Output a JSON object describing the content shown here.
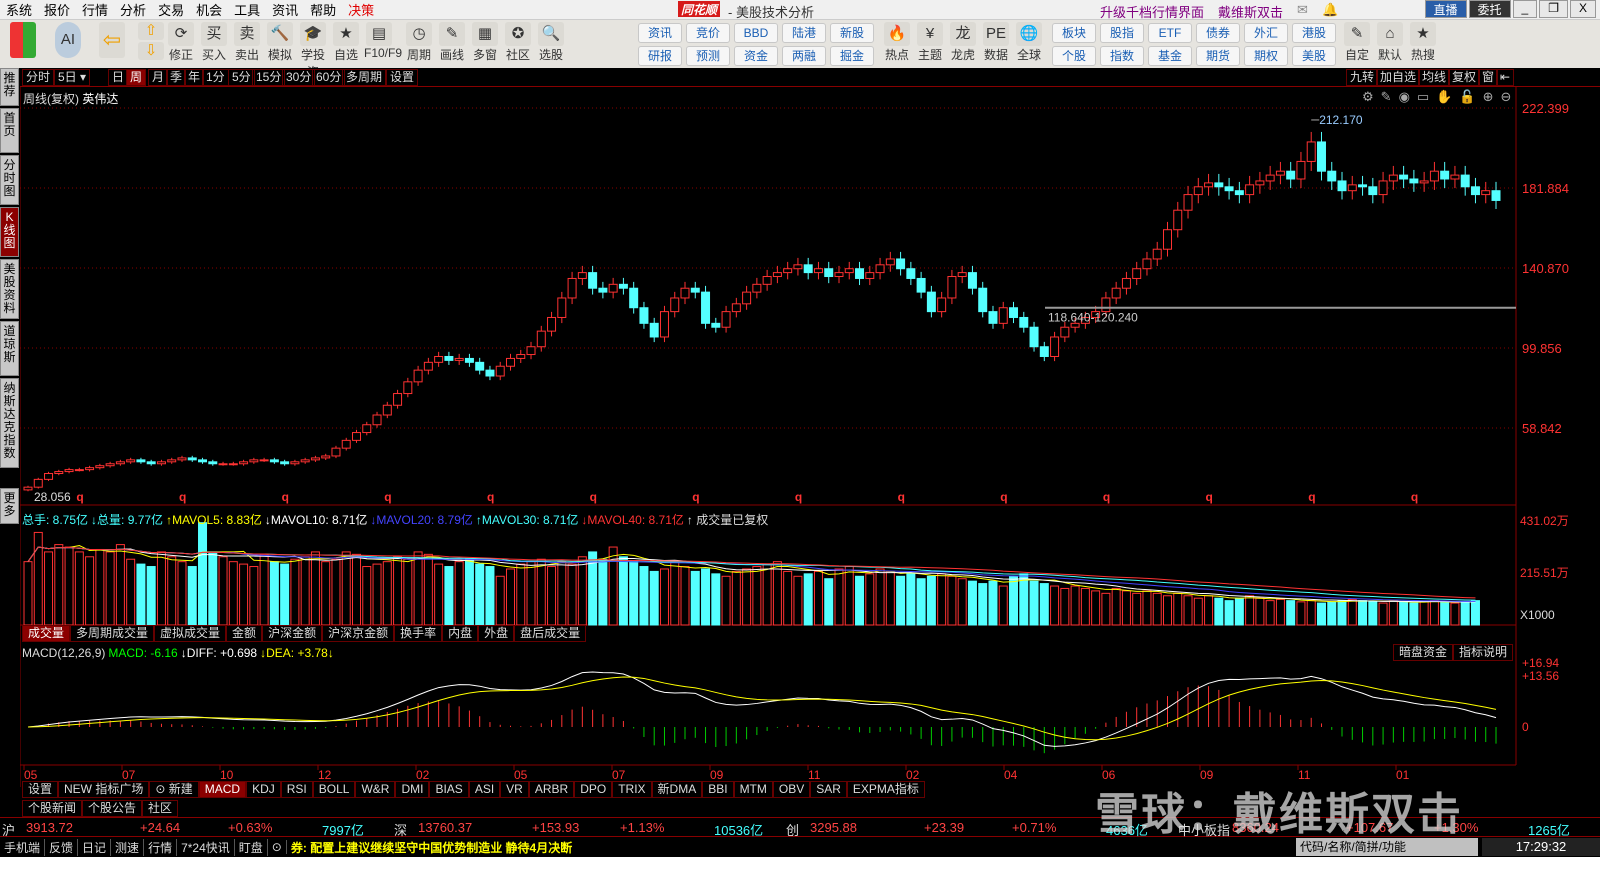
{
  "menu": [
    "系统",
    "报价",
    "行情",
    "分析",
    "交易",
    "机会",
    "工具",
    "资讯",
    "帮助",
    "决策"
  ],
  "app": {
    "logo": "同花顺",
    "title": "- 美股技术分析",
    "links": [
      "升级千档行情界面",
      "戴维斯双击"
    ],
    "live": "直播",
    "entrust": "委托",
    "minimize": "_",
    "restore": "❐",
    "close": "X"
  },
  "toolbar": {
    "big": [
      {
        "label": "修正",
        "icon": "⟳"
      },
      {
        "label": "买入",
        "icon": "买"
      },
      {
        "label": "卖出",
        "icon": "卖"
      },
      {
        "label": "模拟",
        "icon": "🔨"
      },
      {
        "label": "学投资",
        "icon": "🎓"
      },
      {
        "label": "自选",
        "icon": "★"
      },
      {
        "label": "F10/F9",
        "icon": "▤"
      },
      {
        "label": "周期",
        "icon": "◷"
      },
      {
        "label": "画线",
        "icon": "✎"
      },
      {
        "label": "多窗",
        "icon": "▦"
      },
      {
        "label": "社区",
        "icon": "✪"
      },
      {
        "label": "选股",
        "icon": "🔍"
      }
    ],
    "small": [
      [
        "资讯",
        "研报"
      ],
      [
        "竞价",
        "预测"
      ],
      [
        "BBD",
        "资金"
      ],
      [
        "陆港",
        "两融"
      ],
      [
        "新股",
        "掘金"
      ]
    ],
    "big2": [
      {
        "label": "热点",
        "icon": "🔥"
      },
      {
        "label": "主题",
        "icon": "¥"
      },
      {
        "label": "龙虎",
        "icon": "龙"
      },
      {
        "label": "数据",
        "icon": "PE"
      },
      {
        "label": "全球",
        "icon": "🌐"
      }
    ],
    "small2": [
      [
        "板块",
        "个股"
      ],
      [
        "股指",
        "指数"
      ],
      [
        "ETF",
        "基金"
      ],
      [
        "债券",
        "期货"
      ],
      [
        "外汇",
        "期权"
      ],
      [
        "港股",
        "美股"
      ]
    ],
    "big3": [
      {
        "label": "自定",
        "icon": "✎"
      },
      {
        "label": "默认",
        "icon": "⌂"
      },
      {
        "label": "热搜",
        "icon": "★"
      }
    ]
  },
  "periods": [
    "分时",
    "5日 ▾",
    "日",
    "周",
    "月",
    "季",
    "年",
    "1分",
    "5分",
    "15分",
    "30分",
    "60分",
    "多周期",
    "设置"
  ],
  "right_tabs": [
    "九转",
    "加自选",
    "均线",
    "复权",
    "窗",
    "⇤"
  ],
  "sidebar": [
    "推荐",
    "首页",
    "分时图",
    "K线图",
    "美股资料",
    "道琼斯",
    "纳斯达克指数",
    "更多"
  ],
  "chart": {
    "caption": "周线(复权)",
    "stock": "英伟达",
    "y_ticks": [
      "222.399",
      "181.884",
      "140.870",
      "99.856",
      "58.842"
    ],
    "max_label": "212.170",
    "min_label": "28.056",
    "range_label": "118.640-120.240",
    "q_marker": "q"
  },
  "volume": {
    "items": [
      {
        "t": "总手: 8.75亿",
        "c": "#4ff"
      },
      {
        "t": "↓总量: 9.77亿",
        "c": "#4ff"
      },
      {
        "t": "↑MAVOL5: 8.83亿",
        "c": "#ff0"
      },
      {
        "t": "↓MAVOL10: 8.71亿",
        "c": "#fff"
      },
      {
        "t": "↓MAVOL20: 8.79亿",
        "c": "#44f"
      },
      {
        "t": "↑MAVOL30: 8.71亿",
        "c": "#4ff"
      },
      {
        "t": "↓MAVOL40: 8.71亿",
        "c": "#f33"
      },
      {
        "t": "↑ 成交量已复权",
        "c": "#ddd"
      }
    ],
    "y_ticks": [
      "431.02万",
      "215.51万",
      "X1000"
    ],
    "tabs": [
      "成交量",
      "多周期成交量",
      "虚拟成交量",
      "金额",
      "沪深金额",
      "沪深京金额",
      "换手率",
      "内盘",
      "外盘",
      "盘后成交量"
    ]
  },
  "macd": {
    "items": [
      {
        "t": "MACD(12,26,9)",
        "c": "#ddd"
      },
      {
        "t": "MACD: -6.16",
        "c": "#0f0"
      },
      {
        "t": "↓DIFF: +0.698",
        "c": "#fff"
      },
      {
        "t": "↓DEA: +3.78↓",
        "c": "#ff0"
      }
    ],
    "buttons": [
      "暗盘资金",
      "指标说明"
    ],
    "y_ticks": [
      "+16.94",
      "+13.56",
      "0"
    ]
  },
  "x_ticks": [
    "05",
    "07",
    "10",
    "12",
    "02",
    "05",
    "07",
    "09",
    "11",
    "02",
    "04",
    "06",
    "09",
    "11",
    "01"
  ],
  "indicator_tabs": [
    "设置",
    "NEW 指标广场",
    "⊙ 新建",
    "MACD",
    "KDJ",
    "RSI",
    "BOLL",
    "W&R",
    "DMI",
    "BIAS",
    "ASI",
    "VR",
    "ARBR",
    "DPO",
    "TRIX",
    "新DMA",
    "BBI",
    "MTM",
    "OBV",
    "SAR",
    "EXPMA指标"
  ],
  "news_tabs": [
    "个股新闻",
    "个股公告",
    "社区"
  ],
  "indices": [
    {
      "name": "沪",
      "price": "3913.72",
      "chg": "+24.64",
      "pct": "+0.63%",
      "amt": "7997亿"
    },
    {
      "name": "深",
      "price": "13760.37",
      "chg": "+153.93",
      "pct": "+1.13%",
      "amt": "10536亿"
    },
    {
      "name": "创",
      "price": "3295.88",
      "chg": "+23.39",
      "pct": "+0.71%",
      "amt": "4636亿"
    },
    {
      "name": "中小板指",
      "price": "8360.24",
      "chg": "+107.67",
      "pct": "+1.30%",
      "amt": "1265亿"
    }
  ],
  "status": {
    "items": [
      "手机端",
      "反馈",
      "日记",
      "测速",
      "行情",
      "7*24快讯",
      "盯盘",
      "⊙"
    ],
    "news": "券: 配置上建议继续坚守中国优势制造业 静待4月决断",
    "search_placeholder": "代码/名称/简拼/功能",
    "time": "17:29:32"
  },
  "watermark": "雪球：戴维斯双击",
  "colors": {
    "up": "#ff3232",
    "down": "#54ffff",
    "bg": "#000000",
    "grid": "#800000"
  },
  "chart_data": {
    "type": "candlestick",
    "title": "英伟达 周线(复权)",
    "ylim": [
      28,
      222.399
    ],
    "closes": [
      28,
      32,
      35,
      36,
      37,
      37,
      38,
      39,
      40,
      41,
      42,
      41,
      40,
      41,
      42,
      43,
      42,
      41,
      40,
      40,
      40,
      41,
      42,
      42,
      41,
      40,
      41,
      42,
      43,
      44,
      48,
      52,
      56,
      60,
      65,
      70,
      76,
      82,
      88,
      92,
      95,
      93,
      94,
      92,
      88,
      85,
      90,
      94,
      96,
      100,
      108,
      115,
      125,
      135,
      138,
      130,
      128,
      132,
      130,
      120,
      112,
      105,
      118,
      125,
      130,
      128,
      112,
      110,
      118,
      122,
      128,
      132,
      136,
      138,
      140,
      142,
      138,
      140,
      136,
      138,
      140,
      135,
      138,
      142,
      145,
      140,
      135,
      128,
      118,
      125,
      136,
      138,
      130,
      118,
      112,
      120,
      115,
      110,
      100,
      95,
      105,
      110,
      112,
      115,
      118,
      125,
      130,
      135,
      140,
      145,
      150,
      160,
      170,
      178,
      182,
      184,
      182,
      180,
      178,
      183,
      185,
      188,
      190,
      186,
      195,
      205,
      190,
      185,
      180,
      183,
      182,
      178,
      185,
      188,
      186,
      184,
      185,
      190,
      186,
      188,
      182,
      178,
      180,
      175
    ],
    "volumes": [
      260,
      380,
      300,
      330,
      320,
      300,
      280,
      310,
      300,
      330,
      270,
      250,
      240,
      300,
      280,
      260,
      240,
      420,
      300,
      280,
      260,
      250,
      240,
      290,
      260,
      250,
      270,
      280,
      300,
      260,
      270,
      300,
      290,
      240,
      250,
      260,
      280,
      270,
      300,
      290,
      250,
      240,
      260,
      270,
      250,
      240,
      200,
      230,
      250,
      260,
      270,
      240,
      260,
      250,
      280,
      300,
      270,
      320,
      280,
      260,
      240,
      220,
      230,
      260,
      240,
      220,
      230,
      210,
      200,
      220,
      230,
      240,
      250,
      260,
      220,
      200,
      210,
      220,
      190,
      230,
      240,
      200,
      210,
      230,
      220,
      200,
      210,
      190,
      200,
      210,
      200,
      190,
      180,
      170,
      180,
      160,
      200,
      210,
      180,
      170,
      160,
      150,
      160,
      150,
      140,
      130,
      150,
      140,
      130,
      140,
      130,
      120,
      130,
      120,
      110,
      120,
      110,
      100,
      110,
      120,
      110,
      100,
      105,
      100,
      95,
      100,
      90,
      95,
      100,
      105,
      100,
      95,
      90,
      100,
      95,
      90,
      95,
      100,
      95,
      90,
      95,
      100
    ]
  }
}
